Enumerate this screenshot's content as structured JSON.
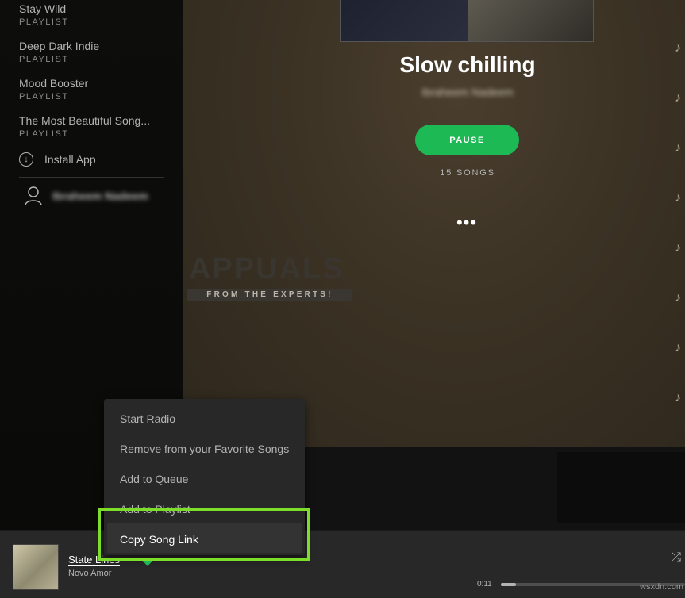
{
  "sidebar": {
    "playlists": [
      {
        "name": "Stay Wild",
        "type": "PLAYLIST"
      },
      {
        "name": "Deep Dark Indie",
        "type": "PLAYLIST"
      },
      {
        "name": "Mood Booster",
        "type": "PLAYLIST"
      },
      {
        "name": "The Most Beautiful Song...",
        "type": "PLAYLIST"
      }
    ],
    "install_label": "Install App",
    "user_name": "Ibraheem Nadeem"
  },
  "playlist_view": {
    "title": "Slow chilling",
    "owner": "Ibraheem Nadeem",
    "pause_label": "PAUSE",
    "song_count": "15 SONGS",
    "more_label": "•••"
  },
  "context_menu": {
    "items": [
      "Start Radio",
      "Remove from your Favorite Songs",
      "Add to Queue",
      "Add to Playlist",
      "Copy Song Link"
    ]
  },
  "player": {
    "track": "State Lines",
    "artist": "Novo Amor",
    "elapsed": "0:11",
    "progress": 0.08
  },
  "watermark": {
    "text": "APPUALS",
    "tagline": "FROM THE EXPERTS!",
    "site": "wsxdn.com"
  },
  "colors": {
    "accent": "#1db954",
    "callout": "#7dde2a"
  }
}
